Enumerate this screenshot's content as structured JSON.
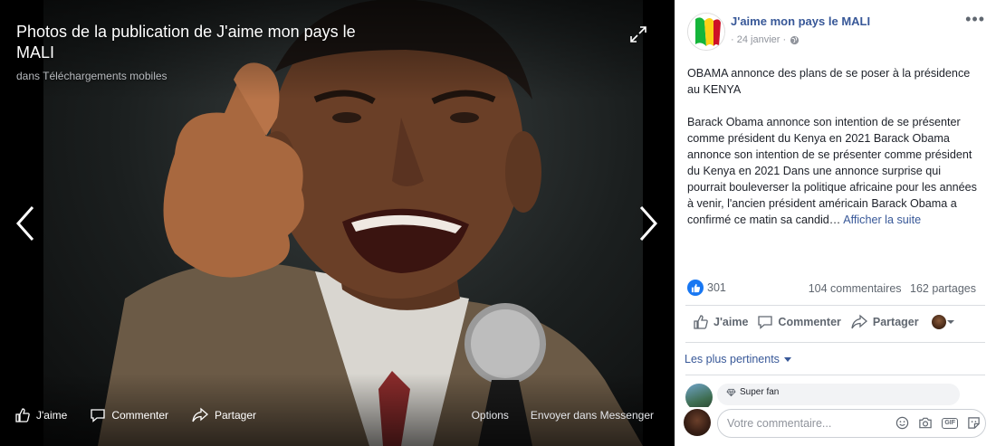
{
  "viewer": {
    "title": "Photos de la publication de J'aime mon pays le MALI",
    "subtitle": "dans Téléchargements mobiles",
    "expand_icon": "expand-icon",
    "prev_icon": "chevron-left-icon",
    "next_icon": "chevron-right-icon",
    "actions": {
      "like": "J'aime",
      "comment": "Commenter",
      "share": "Partager",
      "options": "Options",
      "messenger": "Envoyer dans Messenger"
    }
  },
  "post": {
    "page_name": "J'aime mon pays le MALI",
    "date": "· 24 janvier ·",
    "privacy_icon": "globe-icon",
    "more_label": "•••",
    "paragraph1": "OBAMA annonce des plans de se poser à la présidence au KENYA",
    "paragraph2": "Barack Obama annonce son intention de se présenter comme président du Kenya en 2021 Barack Obama annonce son intention de se présenter comme président du Kenya en 2021 Dans une annonce surprise qui pourrait bouleverser la politique africaine pour les années à venir, l'ancien président américain Barack Obama a confirmé ce matin sa candid…",
    "see_more": "Afficher la suite",
    "likes_count": "301",
    "comments_count": "104 commentaires",
    "shares_count": "162 partages",
    "actions": {
      "like": "J'aime",
      "comment": "Commenter",
      "share": "Partager"
    },
    "filter_label": "Les plus pertinents",
    "comment_preview": {
      "badge": "Super fan"
    },
    "composer": {
      "placeholder": "Votre commentaire...",
      "icons": [
        "emoji-icon",
        "camera-icon",
        "gif-icon",
        "sticker-icon"
      ],
      "gif_label": "GIF"
    }
  },
  "colors": {
    "link": "#385898",
    "like_blue": "#1877f2",
    "panel_bg": "#ffffff",
    "viewer_bg": "#000000"
  }
}
